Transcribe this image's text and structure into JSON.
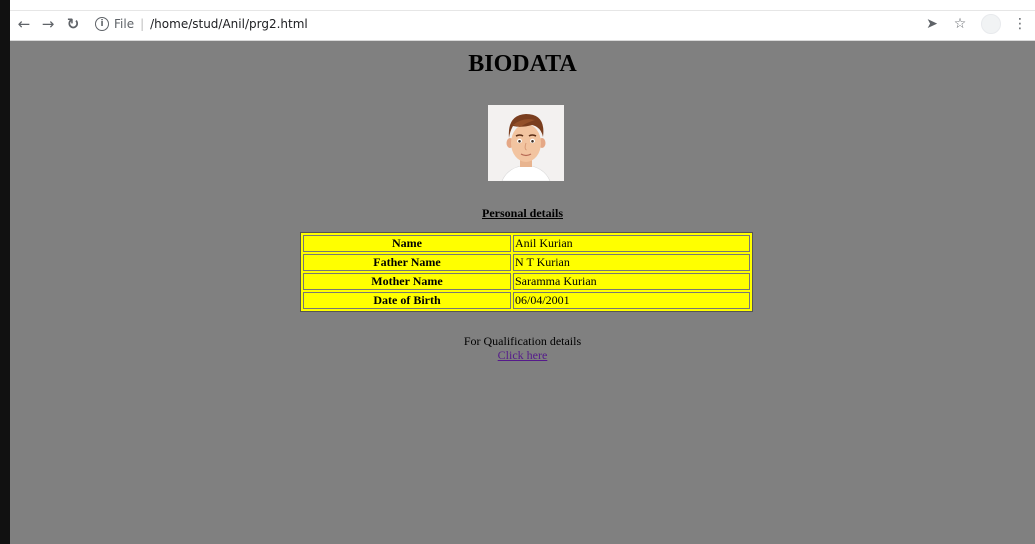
{
  "browser": {
    "scheme": "File",
    "path": "/home/stud/Anil/prg2.html",
    "icons": [
      "back-icon",
      "forward-icon",
      "reload-icon",
      "info-icon",
      "send-icon",
      "star-icon",
      "menu-icon"
    ]
  },
  "page": {
    "heading": "BIODATA",
    "section_title": "Personal details",
    "table": {
      "rows": [
        {
          "label": "Name",
          "value": "Anil Kurian"
        },
        {
          "label": "Father Name",
          "value": "N T Kurian"
        },
        {
          "label": "Mother Name",
          "value": "Saramma Kurian"
        },
        {
          "label": "Date of Birth",
          "value": "06/04/2001"
        }
      ]
    },
    "qualification_text": "For Qualification details",
    "qualification_link": "Click here"
  },
  "colors": {
    "page_background": "#808080",
    "table_background": "#ffff00",
    "link": "#551a8b"
  }
}
